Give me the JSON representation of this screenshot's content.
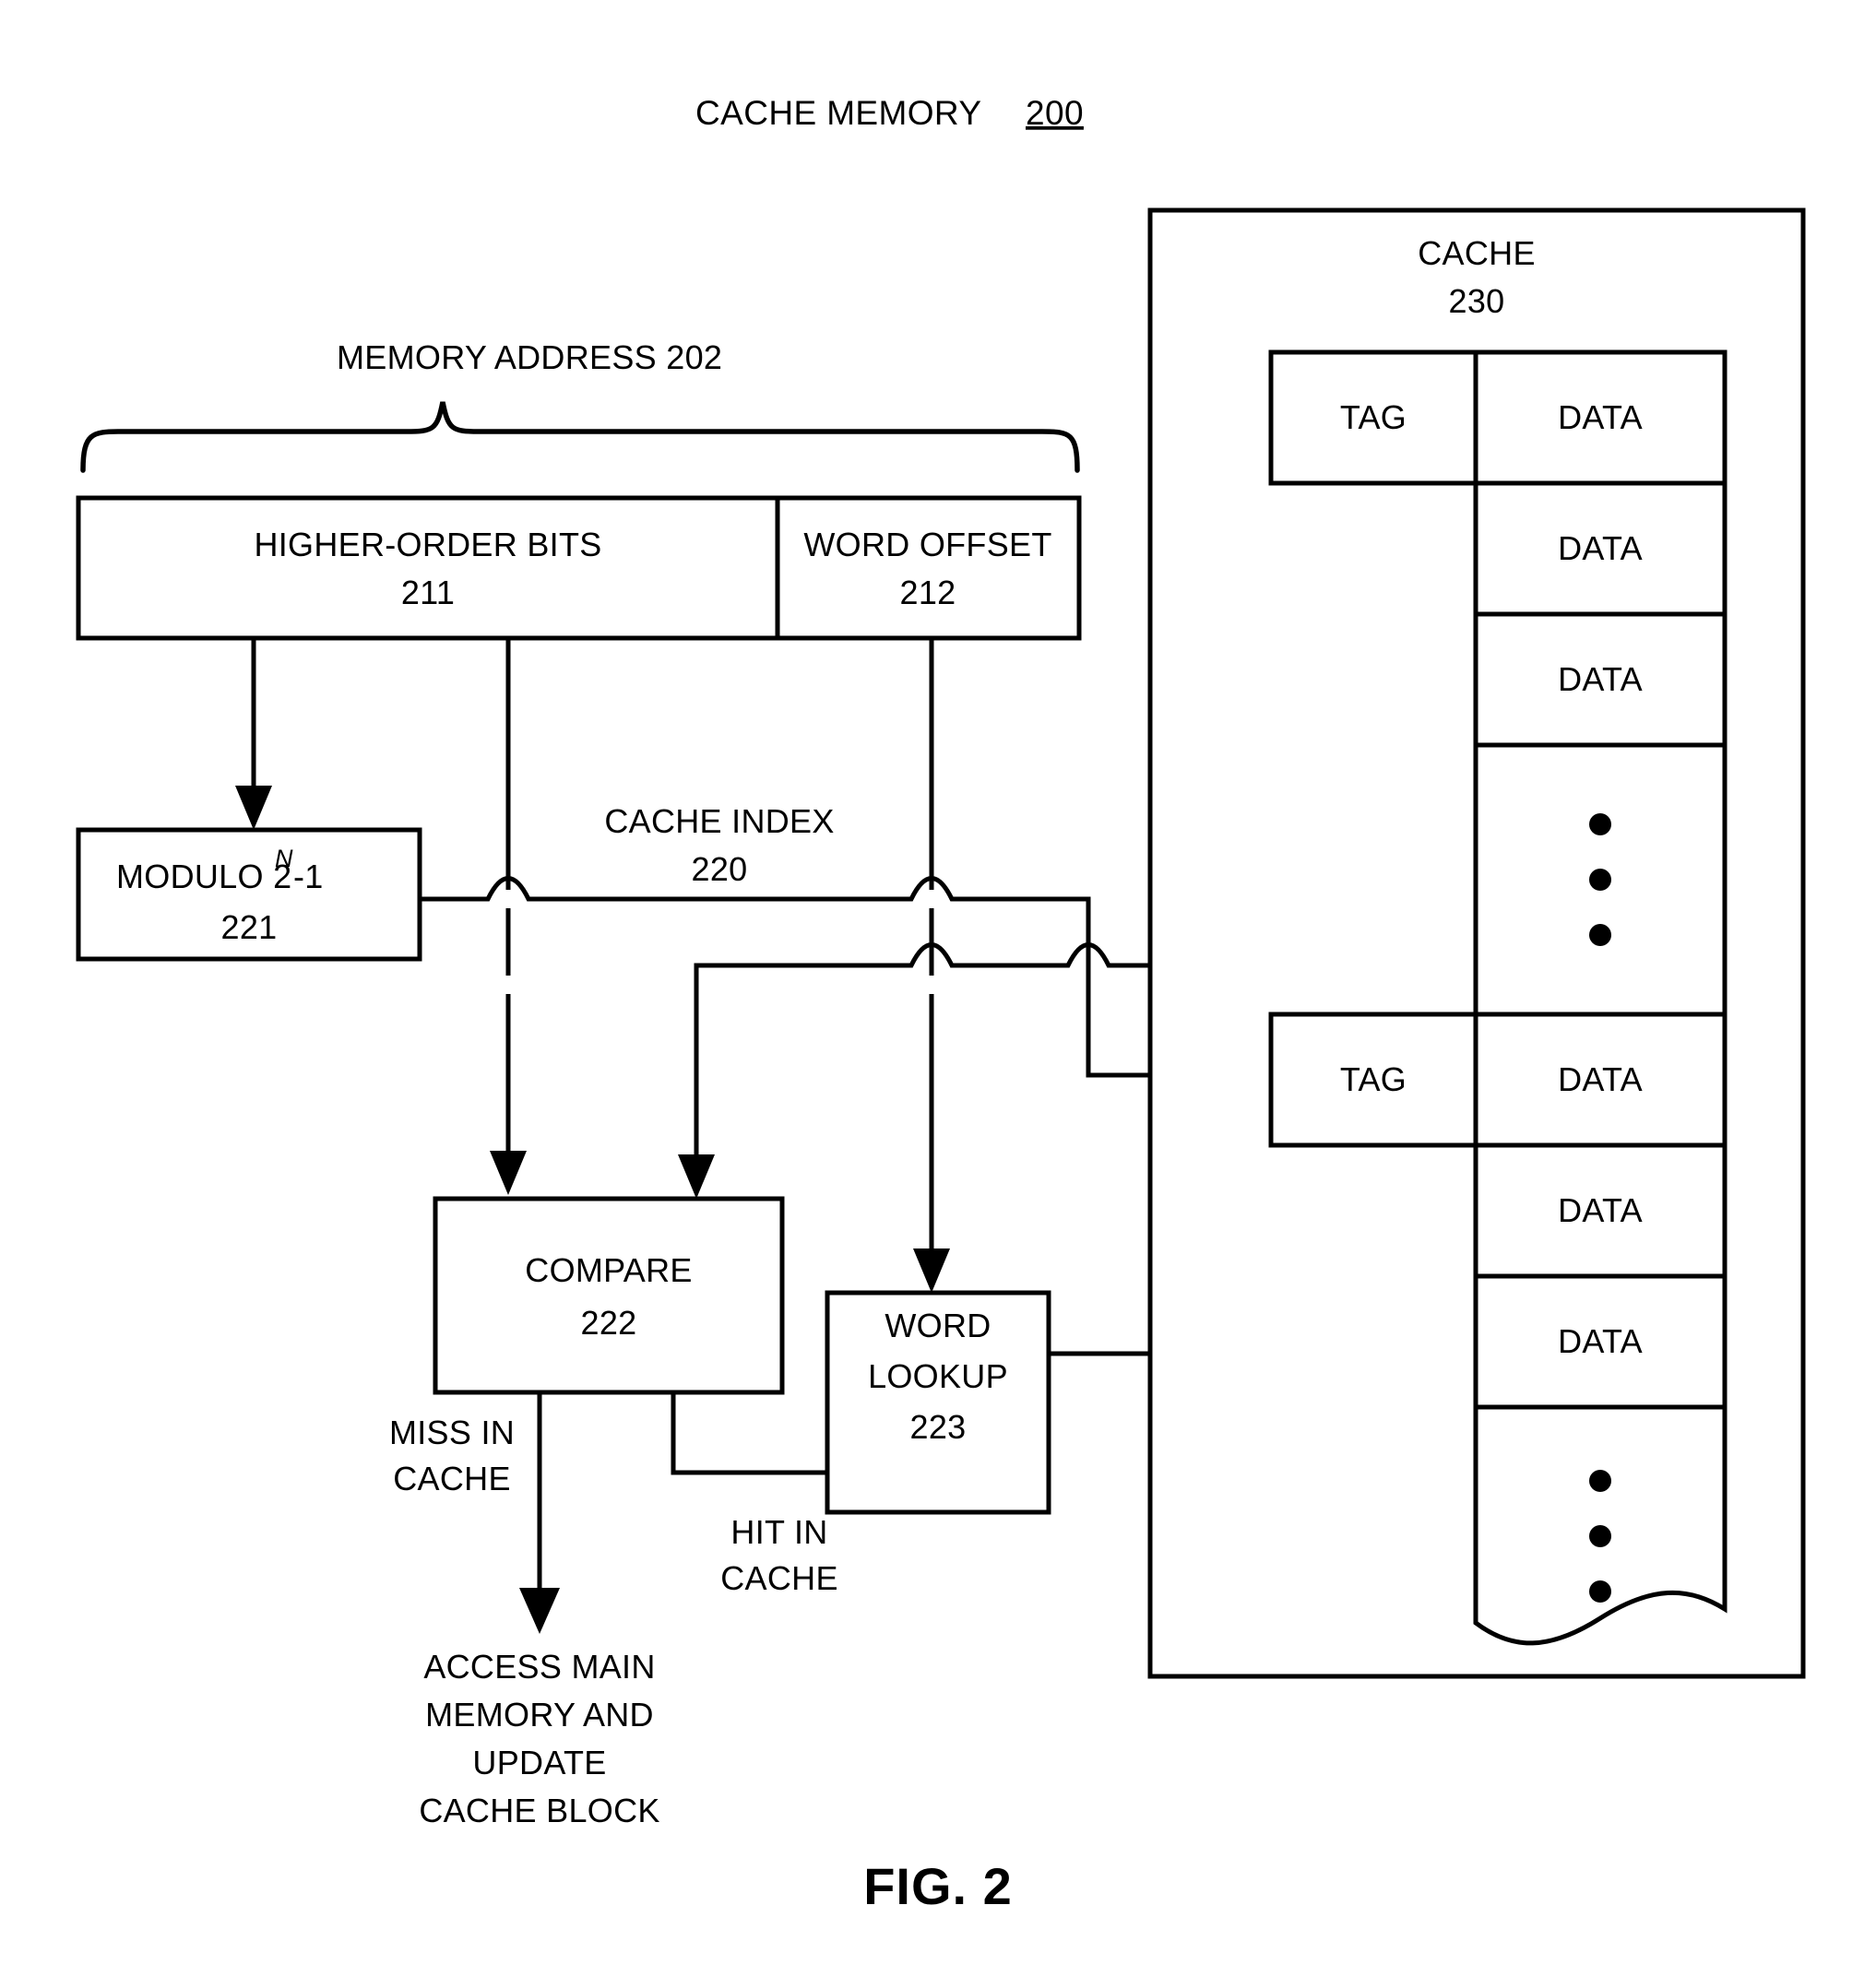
{
  "figure": {
    "title": "CACHE MEMORY",
    "title_ref": "200",
    "caption": "FIG. 2"
  },
  "memory_address": {
    "label": "MEMORY ADDRESS 202",
    "fields": [
      {
        "name": "HIGHER-ORDER BITS",
        "ref": "211"
      },
      {
        "name": "WORD OFFSET",
        "ref": "212"
      }
    ]
  },
  "blocks": {
    "modulo": {
      "name": "MODULO 2",
      "exponent": "N",
      "suffix": "-1",
      "ref": "221"
    },
    "compare": {
      "name": "COMPARE",
      "ref": "222"
    },
    "word_lookup": {
      "name_line1": "WORD",
      "name_line2": "LOOKUP",
      "ref": "223"
    }
  },
  "signals": {
    "cache_index": {
      "name": "CACHE INDEX",
      "ref": "220"
    },
    "miss": {
      "line1": "MISS IN",
      "line2": "CACHE"
    },
    "hit": {
      "line1": "HIT IN",
      "line2": "CACHE"
    }
  },
  "outcome": {
    "line1": "ACCESS MAIN",
    "line2": "MEMORY AND",
    "line3": "UPDATE",
    "line4": "CACHE BLOCK"
  },
  "cache": {
    "name": "CACHE",
    "ref": "230",
    "rows": [
      {
        "tag": "TAG",
        "data": "DATA"
      },
      {
        "tag": "",
        "data": "DATA"
      },
      {
        "tag": "",
        "data": "DATA"
      },
      {
        "tag": "",
        "data": "•••"
      },
      {
        "tag": "TAG",
        "data": "DATA"
      },
      {
        "tag": "",
        "data": "DATA"
      },
      {
        "tag": "",
        "data": "DATA"
      },
      {
        "tag": "",
        "data": "•••"
      }
    ],
    "column_headers": {
      "tag": "TAG",
      "data": "DATA"
    }
  },
  "colors": {
    "stroke": "#000000",
    "background": "#ffffff"
  }
}
